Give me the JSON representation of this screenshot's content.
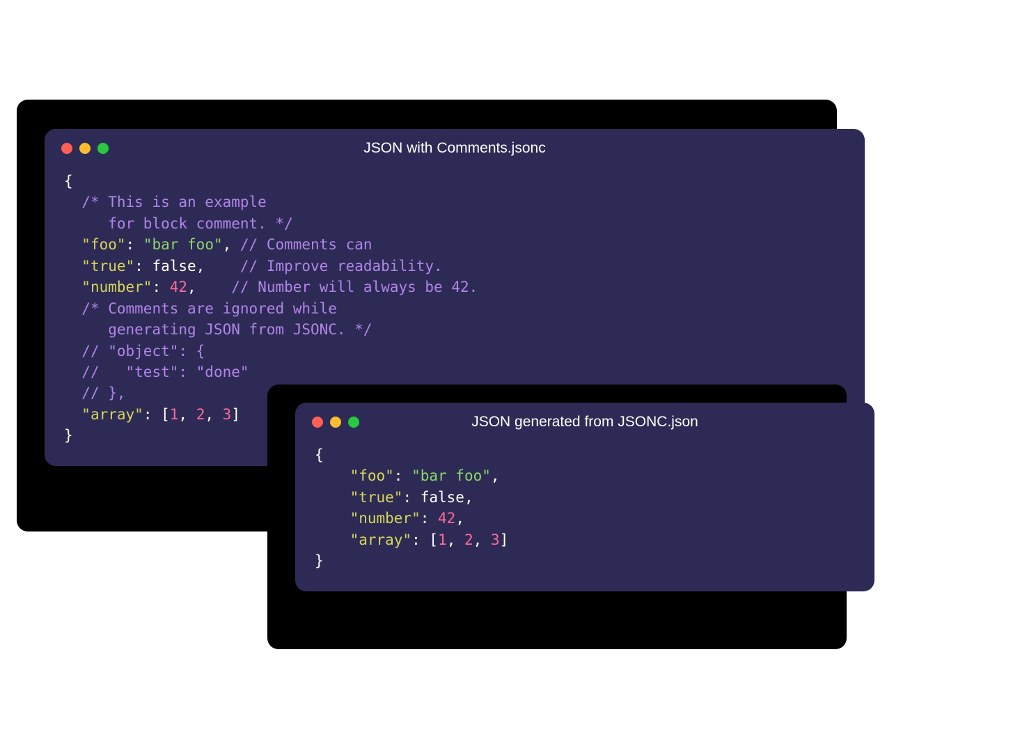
{
  "colors": {
    "window_bg": "#2d2b55",
    "comment": "#b184e8",
    "key": "#d7d55a",
    "string": "#8fd66a",
    "number": "#ff6a9b",
    "punct": "#ffffff",
    "bool": "#ffffff",
    "traffic_red": "#ff5f57",
    "traffic_yellow": "#febc2e",
    "traffic_green": "#28c840"
  },
  "window1": {
    "title": "JSON with Comments.jsonc",
    "code": [
      [
        [
          "punct",
          "{"
        ]
      ],
      [
        [
          "punct",
          "  "
        ],
        [
          "comment",
          "/* This is an example"
        ]
      ],
      [
        [
          "comment",
          "     for block comment. */"
        ]
      ],
      [
        [
          "punct",
          "  "
        ],
        [
          "key",
          "\"foo\""
        ],
        [
          "punct",
          ": "
        ],
        [
          "string",
          "\"bar foo\""
        ],
        [
          "punct",
          ", "
        ],
        [
          "comment",
          "// Comments can"
        ]
      ],
      [
        [
          "punct",
          "  "
        ],
        [
          "key",
          "\"true\""
        ],
        [
          "punct",
          ": "
        ],
        [
          "bool",
          "false"
        ],
        [
          "punct",
          ",    "
        ],
        [
          "comment",
          "// Improve readability."
        ]
      ],
      [
        [
          "punct",
          "  "
        ],
        [
          "key",
          "\"number\""
        ],
        [
          "punct",
          ": "
        ],
        [
          "number",
          "42"
        ],
        [
          "punct",
          ",    "
        ],
        [
          "comment",
          "// Number will always be 42."
        ]
      ],
      [
        [
          "punct",
          "  "
        ],
        [
          "comment",
          "/* Comments are ignored while"
        ]
      ],
      [
        [
          "comment",
          "     generating JSON from JSONC. */"
        ]
      ],
      [
        [
          "punct",
          "  "
        ],
        [
          "comment",
          "// \"object\": {"
        ]
      ],
      [
        [
          "punct",
          "  "
        ],
        [
          "comment",
          "//   \"test\": \"done\""
        ]
      ],
      [
        [
          "punct",
          "  "
        ],
        [
          "comment",
          "// },"
        ]
      ],
      [
        [
          "punct",
          "  "
        ],
        [
          "key",
          "\"array\""
        ],
        [
          "punct",
          ": ["
        ],
        [
          "number",
          "1"
        ],
        [
          "punct",
          ", "
        ],
        [
          "number",
          "2"
        ],
        [
          "punct",
          ", "
        ],
        [
          "number",
          "3"
        ],
        [
          "punct",
          "]"
        ]
      ],
      [
        [
          "punct",
          "}"
        ]
      ]
    ]
  },
  "window2": {
    "title": "JSON generated from JSONC.json",
    "code": [
      [
        [
          "punct",
          "{"
        ]
      ],
      [
        [
          "punct",
          "    "
        ],
        [
          "key",
          "\"foo\""
        ],
        [
          "punct",
          ": "
        ],
        [
          "string",
          "\"bar foo\""
        ],
        [
          "punct",
          ","
        ]
      ],
      [
        [
          "punct",
          "    "
        ],
        [
          "key",
          "\"true\""
        ],
        [
          "punct",
          ": "
        ],
        [
          "bool",
          "false"
        ],
        [
          "punct",
          ","
        ]
      ],
      [
        [
          "punct",
          "    "
        ],
        [
          "key",
          "\"number\""
        ],
        [
          "punct",
          ": "
        ],
        [
          "number",
          "42"
        ],
        [
          "punct",
          ","
        ]
      ],
      [
        [
          "punct",
          "    "
        ],
        [
          "key",
          "\"array\""
        ],
        [
          "punct",
          ": ["
        ],
        [
          "number",
          "1"
        ],
        [
          "punct",
          ", "
        ],
        [
          "number",
          "2"
        ],
        [
          "punct",
          ", "
        ],
        [
          "number",
          "3"
        ],
        [
          "punct",
          "]"
        ]
      ],
      [
        [
          "punct",
          "}"
        ]
      ]
    ]
  }
}
